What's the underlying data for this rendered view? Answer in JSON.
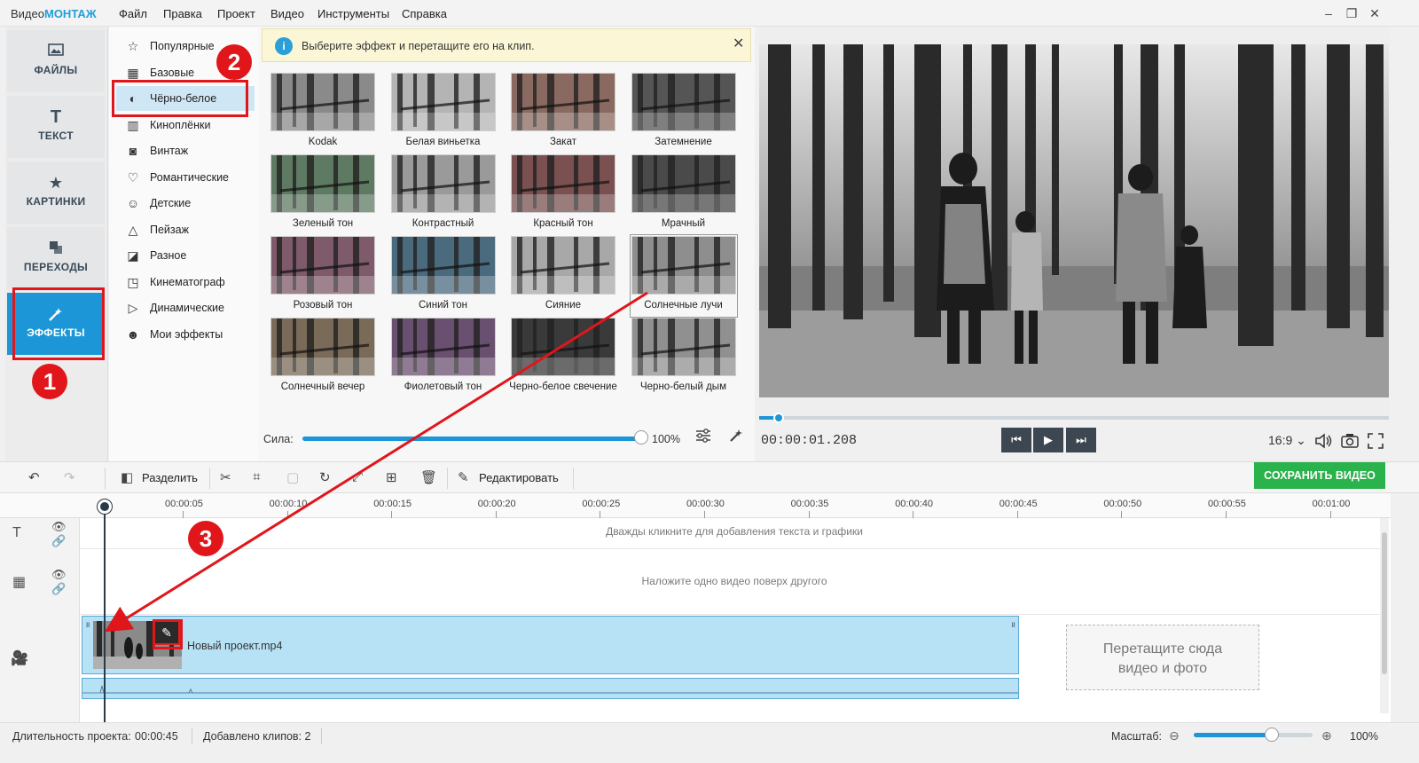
{
  "app": {
    "brand_prefix": "Видео",
    "brand_suffix": "МОНТАЖ",
    "menu": [
      "Файл",
      "Правка",
      "Проект",
      "Видео",
      "Инструменты",
      "Справка"
    ],
    "window_controls": [
      "–",
      "❐",
      "✕"
    ]
  },
  "sidebar": {
    "items": [
      {
        "label": "ФАЙЛЫ",
        "icon": "image-icon"
      },
      {
        "label": "ТЕКСТ",
        "icon": "text-icon"
      },
      {
        "label": "КАРТИНКИ",
        "icon": "star-icon"
      },
      {
        "label": "ПЕРЕХОДЫ",
        "icon": "transitions-icon"
      },
      {
        "label": "ЭФФЕКТЫ",
        "icon": "magic-wand-icon",
        "active": true
      }
    ]
  },
  "categories": [
    {
      "label": "Популярные",
      "icon": "star-outline-icon"
    },
    {
      "label": "Базовые",
      "icon": "grid-icon"
    },
    {
      "label": "Чёрно-белое",
      "icon": "contrast-icon",
      "active": true
    },
    {
      "label": "Киноплёнки",
      "icon": "film-icon"
    },
    {
      "label": "Винтаж",
      "icon": "camera-icon"
    },
    {
      "label": "Романтические",
      "icon": "heart-icon"
    },
    {
      "label": "Детские",
      "icon": "kids-icon"
    },
    {
      "label": "Пейзаж",
      "icon": "mountain-icon"
    },
    {
      "label": "Разное",
      "icon": "misc-icon"
    },
    {
      "label": "Кинематограф",
      "icon": "movie-camera-icon"
    },
    {
      "label": "Динамические",
      "icon": "play-circle-icon"
    },
    {
      "label": "Мои эффекты",
      "icon": "user-icon"
    }
  ],
  "effects": {
    "info_text": "Выберите эффект и перетащите его на клип.",
    "items": [
      {
        "label": "Kodak",
        "tint": "#8a8a8a"
      },
      {
        "label": "Белая виньетка",
        "tint": "#b4b4b4"
      },
      {
        "label": "Закат",
        "tint": "#8a6a60"
      },
      {
        "label": "Затемнение",
        "tint": "#555555"
      },
      {
        "label": "Зеленый тон",
        "tint": "#5e7a62"
      },
      {
        "label": "Контрастный",
        "tint": "#9a9a9a"
      },
      {
        "label": "Красный тон",
        "tint": "#7a5050"
      },
      {
        "label": "Мрачный",
        "tint": "#4a4a4a"
      },
      {
        "label": "Розовый тон",
        "tint": "#7e5a6a"
      },
      {
        "label": "Синий тон",
        "tint": "#4a6a7e"
      },
      {
        "label": "Сияние",
        "tint": "#a8a8a8"
      },
      {
        "label": "Солнечные лучи",
        "tint": "#8e8e8e",
        "selected": true
      },
      {
        "label": "Солнечный вечер",
        "tint": "#7a6a58"
      },
      {
        "label": "Фиолетовый тон",
        "tint": "#6a5070"
      },
      {
        "label": "Черно-белое свечение",
        "tint": "#3a3a3a"
      },
      {
        "label": "Черно-белый дым",
        "tint": "#909090"
      }
    ],
    "strength_label": "Сила:",
    "strength_value": "100%",
    "strength_fraction": 1.0
  },
  "player": {
    "timecode": "00:00:01.208",
    "aspect": "16:9 ⌄",
    "progress_fraction": 0.03
  },
  "toolbar": {
    "split_label": "Разделить",
    "edit_label": "Редактировать",
    "save_label": "СОХРАНИТЬ ВИДЕО"
  },
  "timeline": {
    "ticks": [
      "00:00:05",
      "00:00:10",
      "00:00:15",
      "00:00:20",
      "00:00:25",
      "00:00:30",
      "00:00:35",
      "00:00:40",
      "00:00:45",
      "00:00:50",
      "00:00:55",
      "00:01:00"
    ],
    "text_hint": "Дважды кликните для добавления текста и графики",
    "overlay_hint": "Наложите одно видео поверх другого",
    "clip_name": "Новый проект.mp4",
    "drop_line1": "Перетащите сюда",
    "drop_line2": "видео и фото"
  },
  "status": {
    "duration_label": "Длительность проекта:",
    "duration_value": "00:00:45",
    "clips_label": "Добавлено клипов: 2",
    "scale_label": "Масштаб:",
    "scale_value": "100%",
    "scale_fraction": 0.66
  },
  "annotations": [
    "1",
    "2",
    "3"
  ],
  "colors": {
    "accent": "#1c96d6",
    "save": "#2ab24c",
    "annotation": "#e0161b",
    "clip": "#b7e2f6"
  }
}
